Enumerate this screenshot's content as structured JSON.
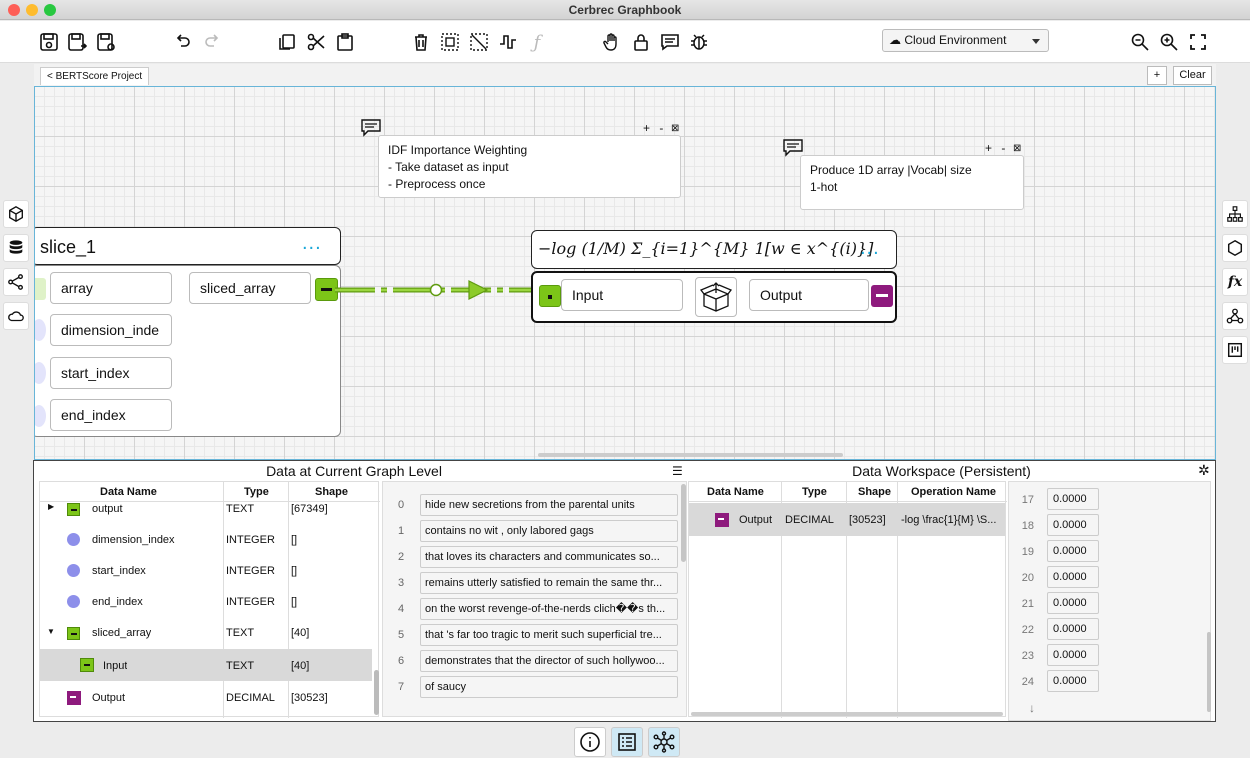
{
  "window": {
    "title": "Cerbrec Graphbook"
  },
  "toolbar": {
    "environment": "Cloud Environment"
  },
  "tabs": {
    "project": "BERTScore Project",
    "add": "+",
    "clear": "Clear"
  },
  "notes": [
    {
      "lines": [
        "IDF Importance Weighting",
        "- Take dataset as input",
        "- Preprocess once"
      ],
      "opts": "+ -"
    },
    {
      "lines": [
        "Produce 1D array |Vocab| size",
        "1-hot"
      ],
      "opts": "+ -"
    }
  ],
  "nodes": {
    "slice": {
      "title": "slice_1",
      "dots": "...",
      "inputs": [
        "array",
        "dimension_inde",
        "start_index",
        "end_index"
      ],
      "output": "sliced_array"
    },
    "formula": {
      "title": "−log (1/M) Σ_{i=1}^{M} 1[w ∈ x^{(i)}]",
      "dots": "...",
      "input": "Input",
      "output": "Output"
    }
  },
  "panel_left": {
    "title": "Data at Current Graph Level",
    "columns": [
      "Data Name",
      "Type",
      "Shape"
    ],
    "rows": [
      {
        "name": "output",
        "type": "TEXT",
        "shape": "[67349]"
      },
      {
        "name": "dimension_index",
        "type": "INTEGER",
        "shape": "[]"
      },
      {
        "name": "start_index",
        "type": "INTEGER",
        "shape": "[]"
      },
      {
        "name": "end_index",
        "type": "INTEGER",
        "shape": "[]"
      },
      {
        "name": "sliced_array",
        "type": "TEXT",
        "shape": "[40]"
      },
      {
        "name": "Input",
        "type": "TEXT",
        "shape": "[40]"
      },
      {
        "name": "Output",
        "type": "DECIMAL",
        "shape": "[30523]"
      }
    ],
    "values": [
      {
        "i": "0",
        "v": "hide new secretions from the parental units"
      },
      {
        "i": "1",
        "v": "contains no wit , only labored gags"
      },
      {
        "i": "2",
        "v": "that loves its characters and communicates so..."
      },
      {
        "i": "3",
        "v": "remains utterly satisfied to remain the same thr..."
      },
      {
        "i": "4",
        "v": "on the worst revenge-of-the-nerds clich��s th..."
      },
      {
        "i": "5",
        "v": "that 's far too tragic to merit such superficial tre..."
      },
      {
        "i": "6",
        "v": "demonstrates that the director of such hollywoo..."
      },
      {
        "i": "7",
        "v": "of saucy"
      }
    ]
  },
  "panel_right": {
    "title": "Data Workspace (Persistent)",
    "columns": [
      "Data Name",
      "Type",
      "Shape",
      "Operation Name"
    ],
    "row": {
      "name": "Output",
      "type": "DECIMAL",
      "shape": "[30523]",
      "op": "-log \\frac{1}{M} \\S..."
    },
    "values": [
      {
        "i": "17",
        "v": "0.0000"
      },
      {
        "i": "18",
        "v": "0.0000"
      },
      {
        "i": "19",
        "v": "0.0000"
      },
      {
        "i": "20",
        "v": "0.0000"
      },
      {
        "i": "21",
        "v": "0.0000"
      },
      {
        "i": "22",
        "v": "0.0000"
      },
      {
        "i": "23",
        "v": "0.0000"
      },
      {
        "i": "24",
        "v": "0.0000"
      }
    ],
    "more": "↓"
  }
}
